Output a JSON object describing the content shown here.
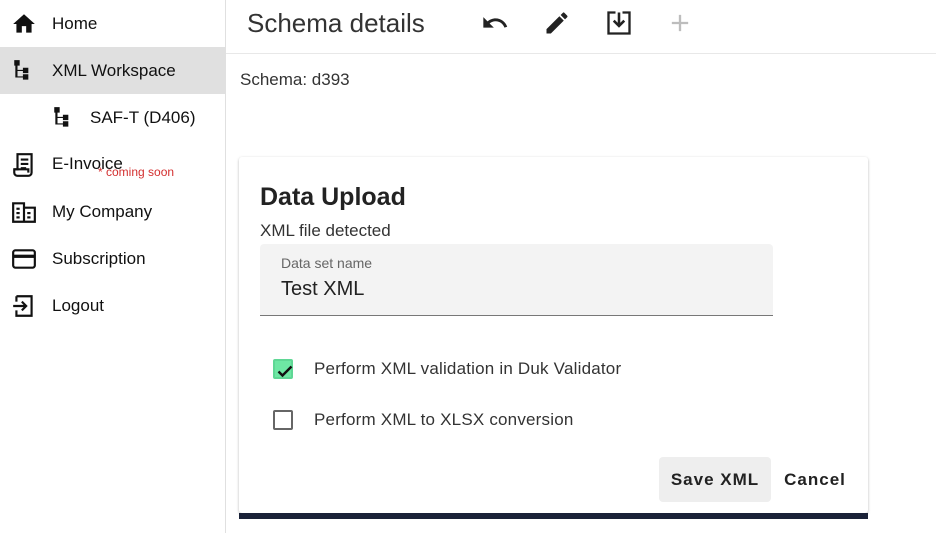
{
  "sidebar": {
    "items": [
      {
        "label": "Home",
        "icon": "home-icon"
      },
      {
        "label": "XML Workspace",
        "icon": "sitemap-icon",
        "active": true
      },
      {
        "label": "SAF-T (D406)",
        "icon": "sitemap-icon"
      },
      {
        "label": "E-Invoice",
        "icon": "receipt-icon",
        "note": "* coming soon"
      },
      {
        "label": "My Company",
        "icon": "domain-icon"
      },
      {
        "label": "Subscription",
        "icon": "credit-card-icon"
      },
      {
        "label": "Logout",
        "icon": "logout-icon"
      }
    ]
  },
  "header": {
    "title": "Schema details",
    "tools": [
      "undo-icon",
      "edit-icon",
      "download-icon",
      "add-icon"
    ]
  },
  "schema": {
    "text": "Schema: d393"
  },
  "dialog": {
    "title": "Data Upload",
    "subtitle": "XML file detected",
    "field_label": "Data set name",
    "field_value": "Test XML",
    "checks": [
      {
        "label": "Perform XML validation in Duk Validator",
        "checked": true
      },
      {
        "label": "Perform XML to XLSX conversion",
        "checked": false
      }
    ],
    "save_label": "Save XML",
    "cancel_label": "Cancel"
  },
  "colors": {
    "active_nav_bg": "#e0e0e0",
    "checkbox_checked": "#6ee7a4",
    "coming_soon": "#d32f2f",
    "card_bar": "#1a2238",
    "disabled_icon": "#bdbdbd"
  }
}
